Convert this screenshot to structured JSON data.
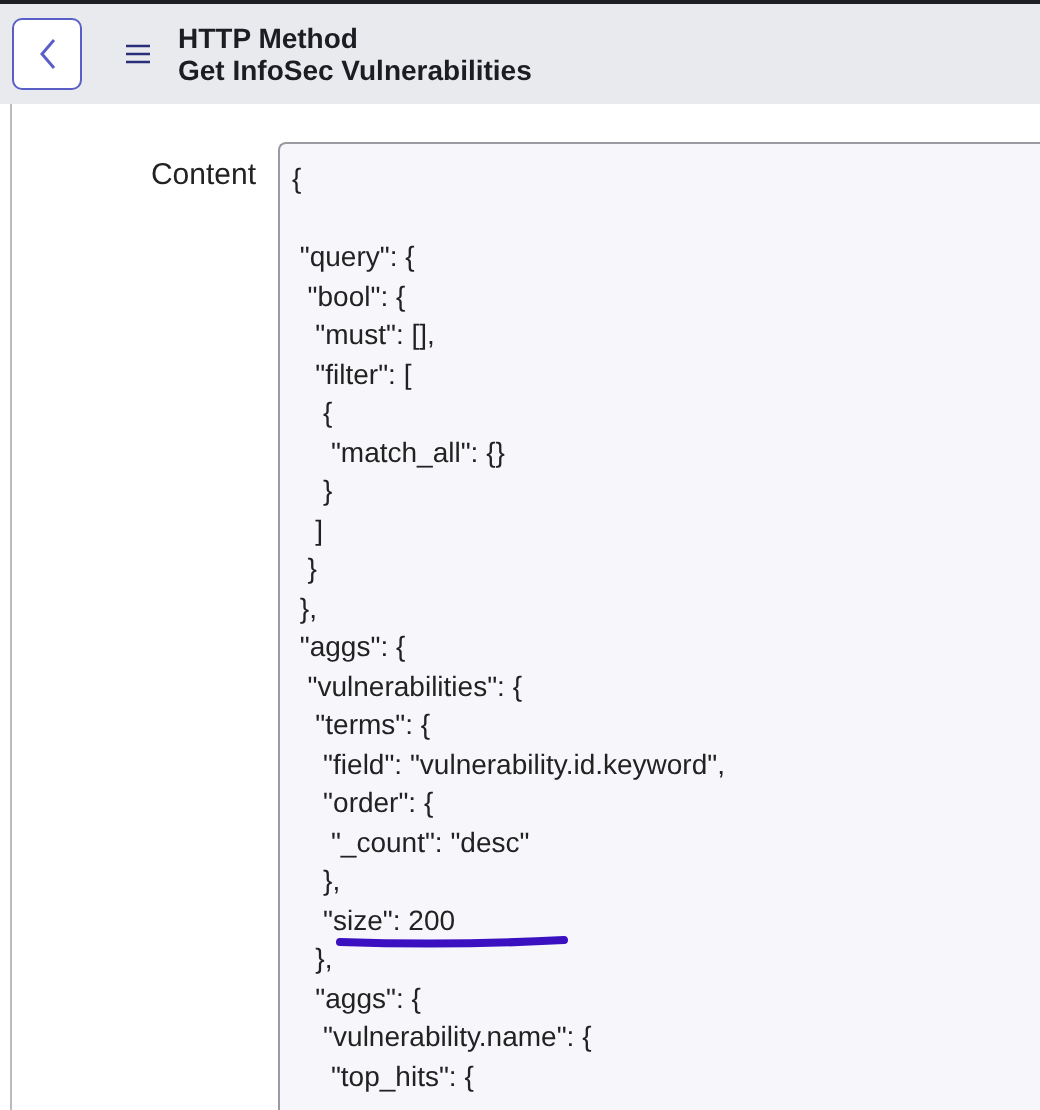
{
  "header": {
    "title": "HTTP Method",
    "subtitle": "Get InfoSec Vulnerabilities"
  },
  "form": {
    "label": "Content",
    "blocks": [
      {
        "lines": [
          {
            "text": "{",
            "underlined": false
          }
        ]
      },
      {
        "lines": [
          {
            "text": " \"query\": {",
            "underlined": false
          },
          {
            "text": "  \"bool\": {",
            "underlined": false
          },
          {
            "text": "   \"must\": [],",
            "underlined": false
          },
          {
            "text": "   \"filter\": [",
            "underlined": false
          },
          {
            "text": "    {",
            "underlined": false
          },
          {
            "text": "     \"match_all\": {}",
            "underlined": false
          },
          {
            "text": "    }",
            "underlined": false
          },
          {
            "text": "   ]",
            "underlined": false
          },
          {
            "text": "  }",
            "underlined": false
          },
          {
            "text": " },",
            "underlined": false
          },
          {
            "text": " \"aggs\": {",
            "underlined": false
          },
          {
            "text": "  \"vulnerabilities\": {",
            "underlined": false
          },
          {
            "text": "   \"terms\": {",
            "underlined": false
          },
          {
            "text": "    \"field\": \"vulnerability.id.keyword\",",
            "underlined": false
          },
          {
            "text": "    \"order\": {",
            "underlined": false
          },
          {
            "text": "     \"_count\": \"desc\"",
            "underlined": false
          },
          {
            "text": "    },",
            "underlined": false
          },
          {
            "text": "    \"size\": 200",
            "underlined": true
          },
          {
            "text": "   },",
            "underlined": false
          },
          {
            "text": "   \"aggs\": {",
            "underlined": false
          },
          {
            "text": "    \"vulnerability.name\": {",
            "underlined": false
          },
          {
            "text": "     \"top_hits\": {",
            "underlined": false
          }
        ]
      }
    ]
  }
}
